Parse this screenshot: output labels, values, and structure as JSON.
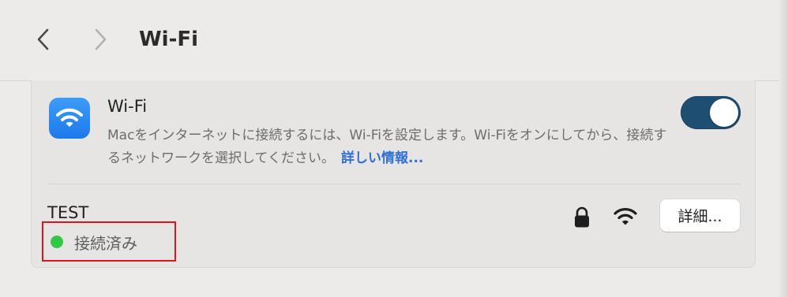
{
  "toolbar": {
    "title": "Wi-Fi",
    "back_icon": "chevron-left-icon",
    "forward_icon": "chevron-right-icon"
  },
  "wifi_section": {
    "title": "Wi-Fi",
    "description": "Macをインターネットに接続するには、Wi-Fiを設定します。Wi-Fiをオンにしてから、接続するネットワークを選択してください。",
    "more_link": "詳しい情報...",
    "toggle_on": true,
    "icon": "wifi-icon"
  },
  "network": {
    "name": "TEST",
    "status": "接続済み",
    "status_color": "#33c748",
    "secured_icon": "lock-icon",
    "signal_icon": "wifi-signal-icon",
    "details_button": "詳細..."
  },
  "colors": {
    "accent": "#2f6fd6",
    "toggle": "#1f4e73",
    "highlight": "#e0141b"
  }
}
